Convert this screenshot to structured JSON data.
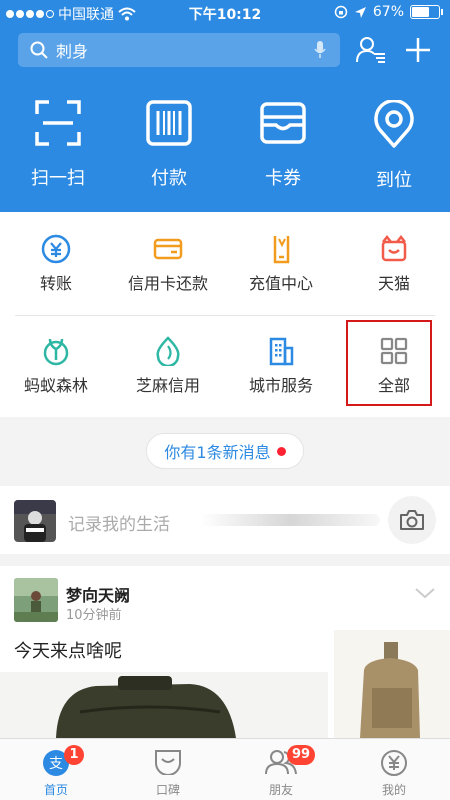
{
  "status_bar": {
    "carrier": "中国联通",
    "time": "下午10:12",
    "battery_text": "67%",
    "battery_level": 0.67
  },
  "search": {
    "placeholder": "刺身"
  },
  "quick_actions": [
    {
      "label": "扫一扫",
      "icon": "scan-icon"
    },
    {
      "label": "付款",
      "icon": "barcode-icon"
    },
    {
      "label": "卡券",
      "icon": "card-wallet-icon"
    },
    {
      "label": "到位",
      "icon": "location-pin-icon"
    }
  ],
  "services": [
    {
      "label": "转账",
      "icon": "transfer-icon"
    },
    {
      "label": "信用卡还款",
      "icon": "credit-card-icon"
    },
    {
      "label": "充值中心",
      "icon": "phone-recharge-icon"
    },
    {
      "label": "天猫",
      "icon": "tmall-icon"
    },
    {
      "label": "蚂蚁森林",
      "icon": "sprout-icon"
    },
    {
      "label": "芝麻信用",
      "icon": "sesame-icon"
    },
    {
      "label": "城市服务",
      "icon": "building-icon"
    },
    {
      "label": "全部",
      "icon": "grid-icon"
    }
  ],
  "message_pill": {
    "text": "你有1条新消息"
  },
  "record": {
    "placeholder": "记录我的生活"
  },
  "post": {
    "author": "梦向天阙",
    "time": "10分钟前",
    "text": "今天来点啥呢"
  },
  "tabs": [
    {
      "label": "首页",
      "badge": "1",
      "active": true
    },
    {
      "label": "口碑",
      "badge": ""
    },
    {
      "label": "朋友",
      "badge": "99"
    },
    {
      "label": "我的",
      "badge": ""
    }
  ],
  "colors": {
    "brand_blue": "#2c8ae2",
    "icon_blue": "#2c8ae2",
    "icon_orange": "#f19b1f",
    "icon_green": "#2eb7a4",
    "icon_red": "#f25a4a",
    "highlight_red": "#d41919"
  }
}
